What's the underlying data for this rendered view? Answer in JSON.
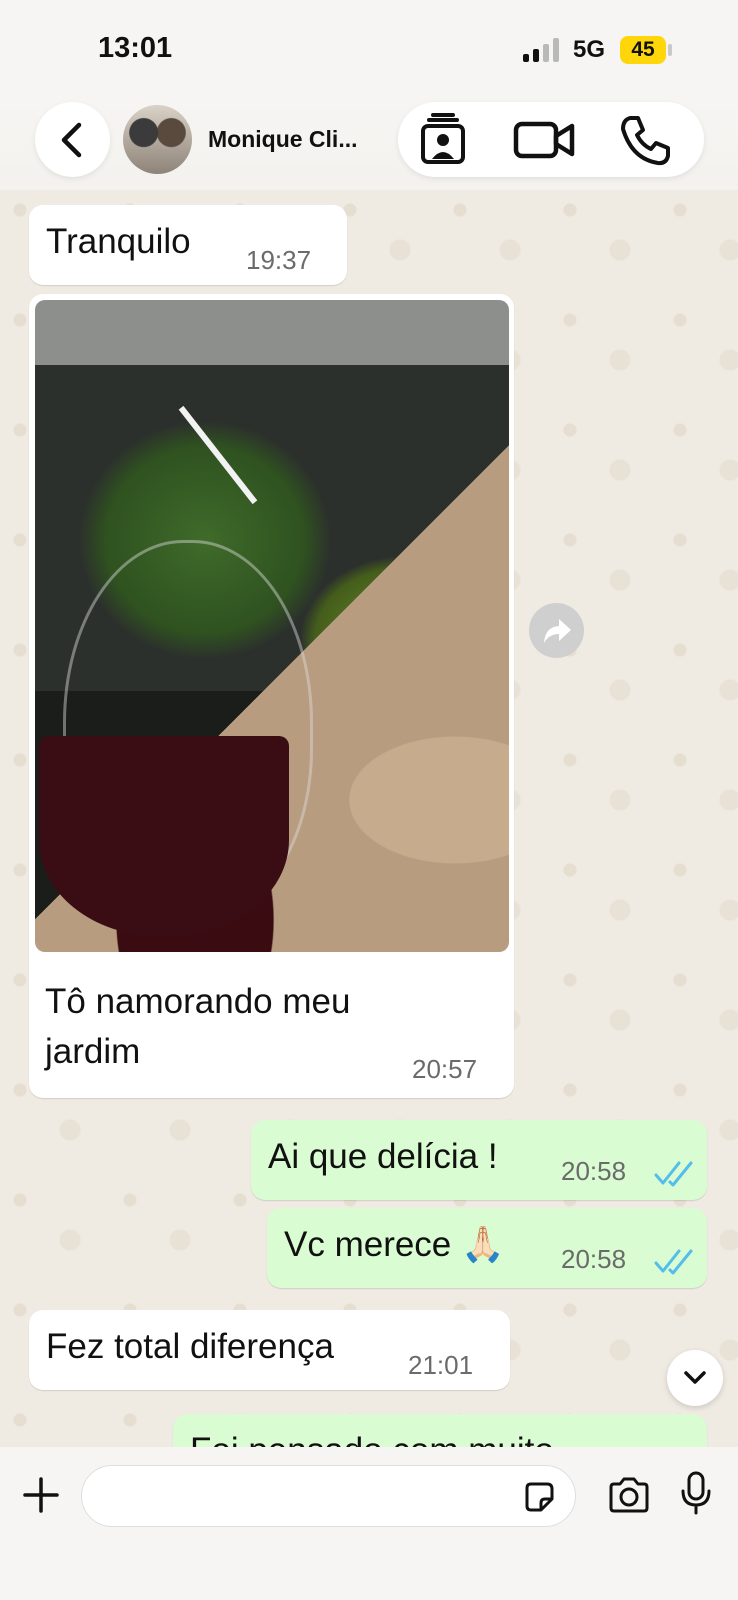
{
  "status_bar": {
    "time": "13:01",
    "network": "5G",
    "battery": "45"
  },
  "header": {
    "contact_name": "Monique Cli...",
    "icons": [
      "back-chevron-icon",
      "contact-card-icon",
      "video-call-icon",
      "voice-call-icon"
    ]
  },
  "messages": [
    {
      "direction": "in",
      "text": "Tranquilo",
      "time": "19:37"
    },
    {
      "direction": "in",
      "type": "photo",
      "caption": "Tô namorando meu jardim",
      "caption_line1": "Tô namorando meu",
      "caption_line2": "jardim",
      "time": "20:57"
    },
    {
      "direction": "out",
      "text": "Ai que delícia !",
      "time": "20:58",
      "status": "read"
    },
    {
      "direction": "out",
      "text": "Vc merece 🙏🏻",
      "time": "20:58",
      "status": "read"
    },
    {
      "direction": "in",
      "text": "Fez total diferença",
      "time": "21:01"
    },
    {
      "direction": "out",
      "text": "Foi pensado com muito",
      "partial": true
    }
  ],
  "composer": {
    "value": "",
    "placeholder": ""
  },
  "colors": {
    "incoming": "#ffffff",
    "outgoing": "#dafcd2",
    "read_ticks": "#53bdeb",
    "battery": "#ffd60a"
  }
}
